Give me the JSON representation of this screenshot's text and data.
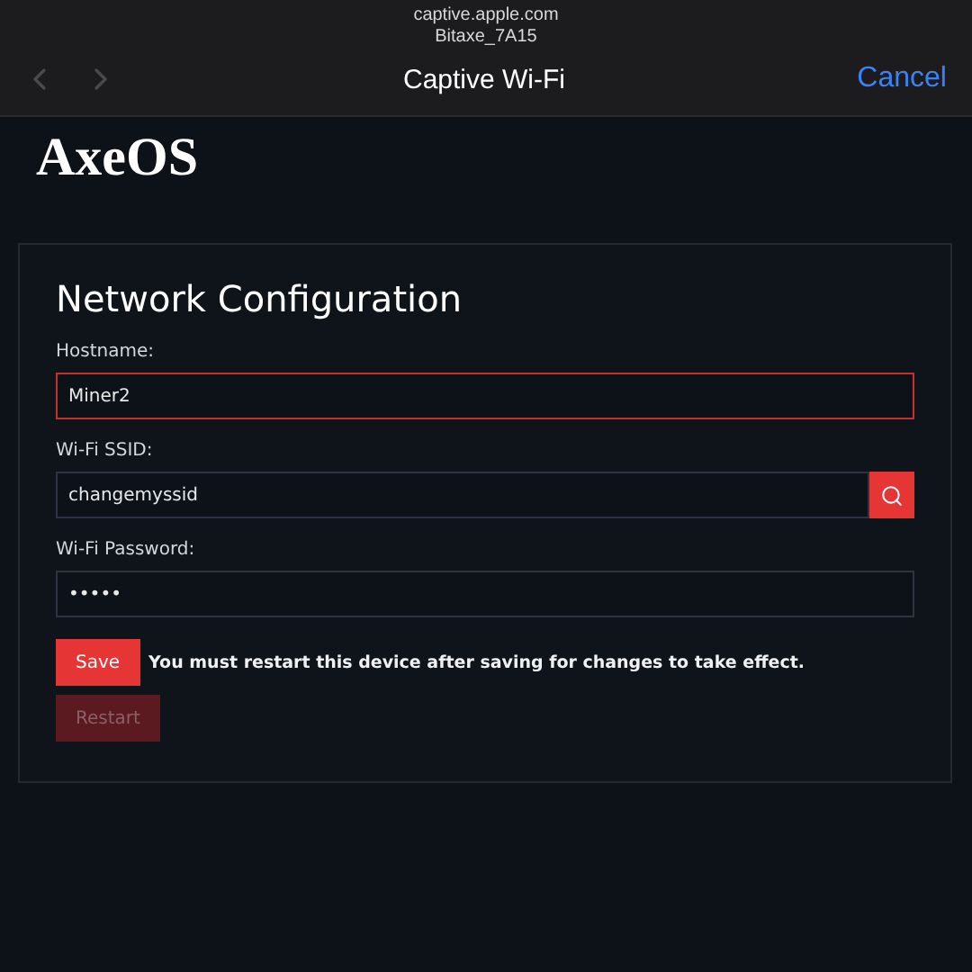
{
  "browser_bar": {
    "url": "captive.apple.com",
    "network": "Bitaxe_7A15",
    "title": "Captive Wi-Fi",
    "back_enabled": false,
    "forward_enabled": false,
    "cancel": "Cancel"
  },
  "logo": "AxeOS",
  "card": {
    "title": "Network Configuration",
    "fields": [
      {
        "label": "Hostname:",
        "value": "Miner2",
        "focused": true,
        "kind": "text"
      },
      {
        "label": "Wi-Fi SSID:",
        "value": "changemyssid",
        "focused": false,
        "kind": "search"
      },
      {
        "label": "Wi-Fi Password:",
        "value": "•••••",
        "focused": false,
        "kind": "text"
      }
    ],
    "save": {
      "label": "Save",
      "disabled": false
    },
    "note": "You must restart this device after saving for changes to take effect.",
    "restart": {
      "label": "Restart",
      "disabled": true
    }
  }
}
